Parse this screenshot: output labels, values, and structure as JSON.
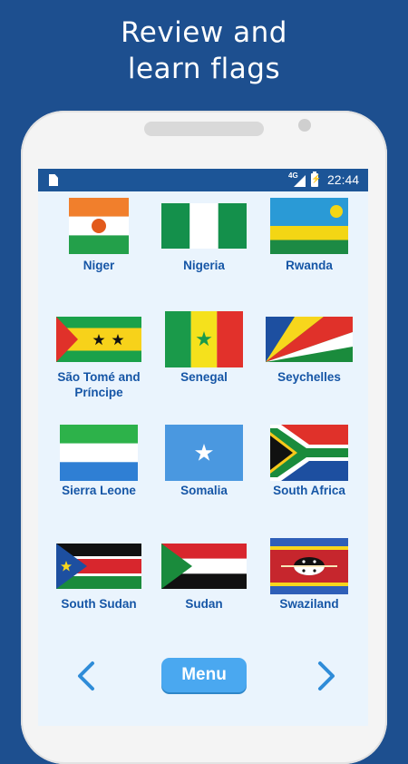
{
  "headline": {
    "line1": "Review and",
    "line2": "learn flags"
  },
  "statusbar": {
    "network": "4G",
    "time": "22:44"
  },
  "countries": [
    {
      "name": "Niger"
    },
    {
      "name": "Nigeria"
    },
    {
      "name": "Rwanda"
    },
    {
      "name": "São Tomé and Príncipe"
    },
    {
      "name": "Senegal"
    },
    {
      "name": "Seychelles"
    },
    {
      "name": "Sierra Leone"
    },
    {
      "name": "Somalia"
    },
    {
      "name": "South Africa"
    },
    {
      "name": "South Sudan"
    },
    {
      "name": "Sudan"
    },
    {
      "name": "Swaziland"
    }
  ],
  "footer": {
    "menu_label": "Menu",
    "prev_icon": "chevron-left-icon",
    "next_icon": "chevron-right-icon"
  },
  "colors": {
    "background": "#1d4f8f",
    "statusbar": "#1c5597",
    "screen": "#eaf4fd",
    "label": "#1656a6",
    "menu_button": "#4aa8f0",
    "arrow": "#2f8cd8"
  }
}
